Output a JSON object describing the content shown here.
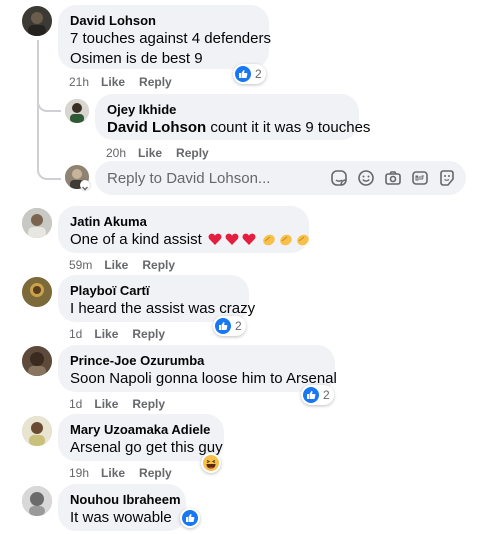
{
  "comments": [
    {
      "author": "David Lohson",
      "line1": "7 touches against 4 defenders",
      "line2": "Osimen is de best 9",
      "time": "21h",
      "like_label": "Like",
      "reply_label": "Reply",
      "reaction_count": "2"
    },
    {
      "author": "Jatin Akuma",
      "text": "One of a kind assist",
      "time": "59m",
      "like_label": "Like",
      "reply_label": "Reply"
    },
    {
      "author": "Playboï Cartï",
      "text": "I heard the assist was crazy",
      "time": "1d",
      "like_label": "Like",
      "reply_label": "Reply",
      "reaction_count": "2"
    },
    {
      "author": "Prince-Joe Ozurumba",
      "text": "Soon Napoli gonna loose him to Arsenal",
      "time": "1d",
      "like_label": "Like",
      "reply_label": "Reply",
      "reaction_count": "2"
    },
    {
      "author": "Mary Uzoamaka Adiele",
      "text": "Arsenal go get this guy",
      "time": "19h",
      "like_label": "Like",
      "reply_label": "Reply"
    },
    {
      "author": "Nouhou Ibraheem",
      "text": "It was wowable"
    }
  ],
  "reply": {
    "author": "Ojey Ikhide",
    "mention": "David Lohson",
    "text": " count it it was 9 touches",
    "time": "20h",
    "like_label": "Like",
    "reply_label": "Reply"
  },
  "reply_input": {
    "placeholder": "Reply to David Lohson..."
  },
  "colors": {
    "bubble": "#f0f2f5",
    "like_blue": "#1877f2",
    "meta_gray": "#65676b",
    "heart_red": "#e41e3f",
    "clap_yellow": "#f7c04a"
  },
  "icons": {
    "tools": [
      "sticker-icon",
      "emoji-icon",
      "camera-icon",
      "gif-icon",
      "sticker-face-icon"
    ],
    "reactions": [
      "like-icon",
      "haha-icon"
    ]
  }
}
